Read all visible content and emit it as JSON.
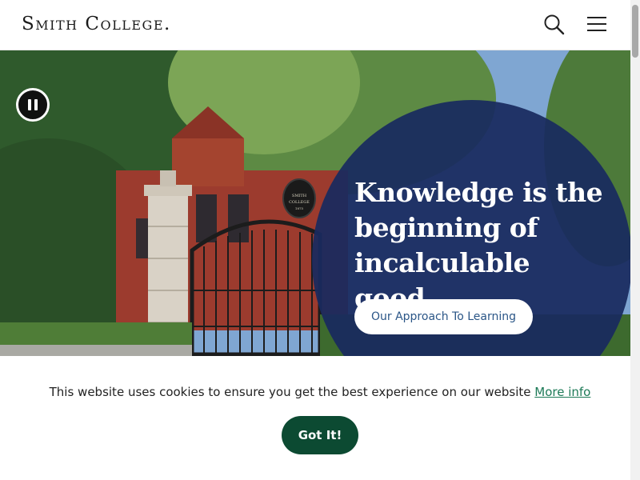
{
  "header": {
    "logo_text": "Smith College",
    "logo_dot": ".",
    "search_icon": "search-icon",
    "menu_icon": "hamburger-menu-icon"
  },
  "hero": {
    "pause_icon": "pause-icon",
    "headline_line1": "Knowledge is the",
    "headline_line2": "beginning of",
    "headline_line3": "incalculable good.",
    "cta_label": "Our Approach To Learning",
    "gate_sign_line1": "SMITH",
    "gate_sign_line2": "COLLEGE",
    "gate_sign_line3": "1875"
  },
  "cookie_banner": {
    "message": "This website uses cookies to ensure you get the best experience on our website",
    "more_info_label": "More info",
    "accept_label": "Got It!"
  },
  "colors": {
    "circle_overlay": "#1c2b5f",
    "accept_button": "#0c4a32",
    "link": "#1d7a57",
    "cta_text": "#2b5687"
  }
}
